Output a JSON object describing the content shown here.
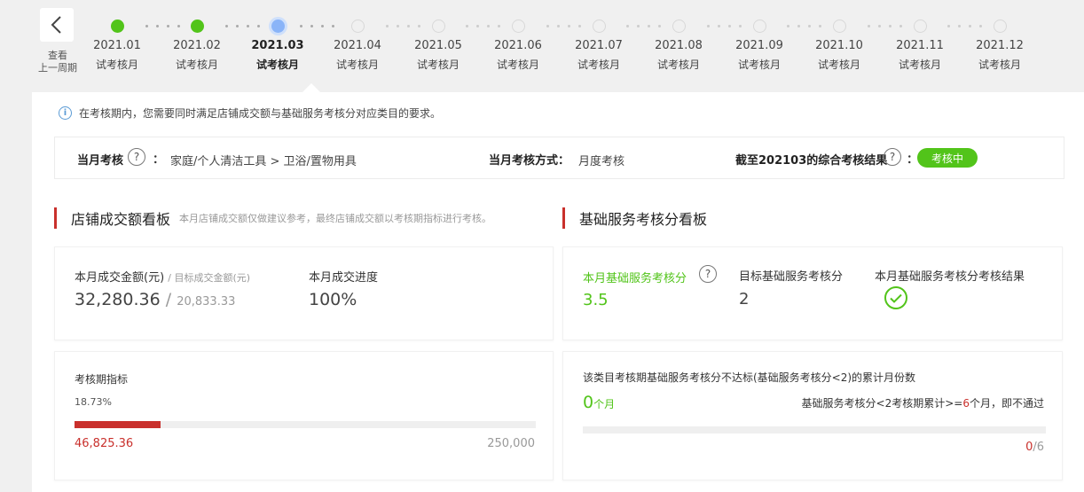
{
  "nav": {
    "back_label_line1": "查看",
    "back_label_line2": "上一周期"
  },
  "timeline": [
    {
      "date": "2021.01",
      "type": "试考核月",
      "status": "done"
    },
    {
      "date": "2021.02",
      "type": "试考核月",
      "status": "done"
    },
    {
      "date": "2021.03",
      "type": "试考核月",
      "status": "current"
    },
    {
      "date": "2021.04",
      "type": "试考核月",
      "status": "future"
    },
    {
      "date": "2021.05",
      "type": "试考核月",
      "status": "future"
    },
    {
      "date": "2021.06",
      "type": "试考核月",
      "status": "future"
    },
    {
      "date": "2021.07",
      "type": "试考核月",
      "status": "future"
    },
    {
      "date": "2021.08",
      "type": "试考核月",
      "status": "future"
    },
    {
      "date": "2021.09",
      "type": "试考核月",
      "status": "future"
    },
    {
      "date": "2021.10",
      "type": "试考核月",
      "status": "future"
    },
    {
      "date": "2021.11",
      "type": "试考核月",
      "status": "future"
    },
    {
      "date": "2021.12",
      "type": "试考核月",
      "status": "future"
    }
  ],
  "notice": {
    "text": "在考核期内，您需要同时满足店铺成交额与基础服务考核分对应类目的要求。"
  },
  "exam": {
    "month_label": "当月考核",
    "colon": "：",
    "category": "家庭/个人清洁工具 > 卫浴/置物用具",
    "method_label": "当月考核方式：",
    "method_value": "月度考核",
    "result_label": "截至202103的综合考核结果",
    "result_status": "考核中"
  },
  "sales_board": {
    "title": "店铺成交额看板",
    "subtitle": "本月店铺成交额仅做建议参考，最终店铺成交额以考核期指标进行考核。",
    "amount_label": "本月成交金额(元)",
    "target_label": "/ 目标成交金额(元)",
    "amount_value": "32,280.36",
    "target_sep": "/",
    "target_value": "20,833.33",
    "progress_label": "本月成交进度",
    "progress_value": "100%",
    "period_label": "考核期指标",
    "period_percent": "18.73%",
    "period_fraction": 0.1873,
    "period_current": "46,825.36",
    "period_target": "250,000"
  },
  "service_board": {
    "title": "基础服务考核分看板",
    "score_label": "本月基础服务考核分",
    "score_value": "3.5",
    "target_label": "目标基础服务考核分",
    "target_value": "2",
    "result_label": "本月基础服务考核分考核结果",
    "fail_title": "该类目考核期基础服务考核分不达标(基础服务考核分<2)的累计月份数",
    "fail_count": "0",
    "fail_unit": "个月",
    "rule_prefix": "基础服务考核分<2考核期累计>=",
    "rule_num": "6",
    "rule_suffix": "个月，即不通过",
    "fail_fraction": 0,
    "fail_current": "0",
    "fail_total": "/6"
  },
  "colors": {
    "accent_green": "#52c41a",
    "accent_red": "#c9302c",
    "current_blue": "#8ab4f8"
  }
}
